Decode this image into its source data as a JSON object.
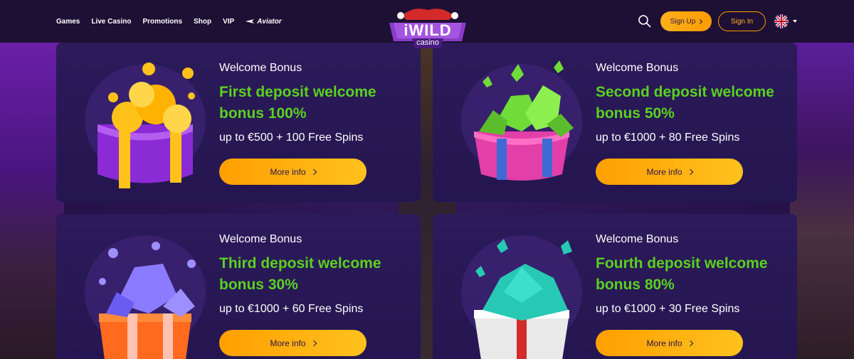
{
  "header": {
    "nav": [
      "Games",
      "Live Casino",
      "Promotions",
      "Shop",
      "VIP",
      "Aviator"
    ],
    "logo_top": "iWILD",
    "logo_bottom": "casino",
    "signup_label": "Sign Up",
    "signin_label": "Sign In",
    "language_icon": "uk-flag-icon"
  },
  "cards": [
    {
      "eyebrow": "Welcome Bonus",
      "title": "First deposit welcome bonus 100%",
      "sub": "up to €500 + 100 Free Spins",
      "button": "More info",
      "gem_color": "#ffc21a",
      "box_color": "#8a2bd6"
    },
    {
      "eyebrow": "Welcome Bonus",
      "title": "Second deposit welcome bonus 50%",
      "sub": "up to €1000 + 80 Free Spins",
      "button": "More info",
      "gem_color": "#6fdc3a",
      "box_color": "#e33fa8"
    },
    {
      "eyebrow": "Welcome Bonus",
      "title": "Third deposit welcome bonus 30%",
      "sub": "up to €1000 + 60 Free Spins",
      "button": "More info",
      "gem_color": "#8b7bff",
      "box_color": "#ff6a1f"
    },
    {
      "eyebrow": "Welcome Bonus",
      "title": "Fourth deposit welcome bonus 80%",
      "sub": "up to €1000 + 30 Free Spins",
      "button": "More info",
      "gem_color": "#27c9b4",
      "box_color": "#e9e9e9"
    }
  ],
  "colors": {
    "accent_green": "#5ad11f",
    "accent_orange": "#ffb11c",
    "header_bg": "#1d1034",
    "card_bg": "#2c1a5a"
  }
}
